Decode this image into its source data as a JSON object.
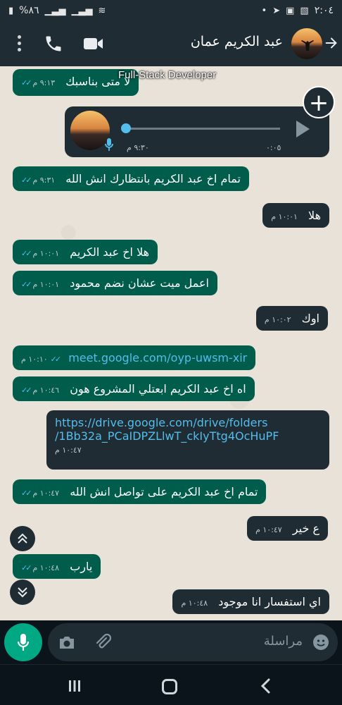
{
  "status_bar": {
    "time": "٢:٠٤",
    "battery": "%٨٦",
    "icons": [
      "telegram-icon",
      "message-icon",
      "gallery-icon",
      "notification-dot-icon",
      "wifi-icon",
      "signal-icon",
      "signal-icon",
      "battery-icon"
    ]
  },
  "header": {
    "contact_name": "عبد الكريم عمان",
    "icons": [
      "back-arrow-icon",
      "avatar",
      "video-call-icon",
      "voice-call-icon",
      "more-options-icon"
    ]
  },
  "watermark": "Full-Stack Developer",
  "messages": [
    {
      "id": "m0",
      "dir": "out",
      "text": "لا متى بناسبك",
      "time": "٩:١٣ م",
      "ticks": "read"
    },
    {
      "id": "voice",
      "dir": "in",
      "type": "voice",
      "time": "٩:٣٠ م",
      "duration": "٠:٠٥"
    },
    {
      "id": "m1",
      "dir": "out",
      "text": "تمام اخ عبد الكريم بانتظارك انش الله",
      "time": "٩:٣١ م",
      "ticks": "read"
    },
    {
      "id": "m2",
      "dir": "in",
      "text": "هلا",
      "time": "١٠:٠١ م"
    },
    {
      "id": "m3",
      "dir": "out",
      "text": "هلا اخ عبد الكريم",
      "time": "١٠:٠١ م",
      "ticks": "read"
    },
    {
      "id": "m4",
      "dir": "out",
      "text": "اعمل ميت عشان نضم محمود",
      "time": "١٠:٠١ م",
      "ticks": "read"
    },
    {
      "id": "m5",
      "dir": "in",
      "text": "اوك",
      "time": "١٠:٠٢ م"
    },
    {
      "id": "m6",
      "dir": "out",
      "text": "meet.google.com/oyp-uwsm-xir",
      "time": "١٠:١٠ م",
      "ticks": "read",
      "link": true
    },
    {
      "id": "m7",
      "dir": "out",
      "text": "اه اخ عبد الكريم ابعتلي المشروع هون",
      "time": "١٠:٤٦ م",
      "ticks": "read"
    },
    {
      "id": "m8",
      "dir": "in",
      "text_line1": "https://drive.google.com/drive/folders",
      "text_line2": "/1Bb32a_PCaIDPZLlwT_ckIyTtg4OcHuPF",
      "time": "١٠:٤٧ م",
      "link": true
    },
    {
      "id": "m9",
      "dir": "out",
      "text": "تمام اخ عبد الكريم على تواصل انش الله",
      "time": "١٠:٤٧ م",
      "ticks": "read"
    },
    {
      "id": "m10",
      "dir": "in",
      "text": "ع خير",
      "time": "١٠:٤٧ م"
    },
    {
      "id": "m11",
      "dir": "out",
      "text": "يارب",
      "time": "١٠:٤٨ م",
      "ticks": "read"
    },
    {
      "id": "m12",
      "dir": "in",
      "text": "اي استفسار انا موجود",
      "time": "١٠:٤٨ م"
    }
  ],
  "input": {
    "placeholder": "مراسلة",
    "icons": [
      "emoji-icon",
      "attach-icon",
      "camera-icon",
      "mic-icon"
    ]
  },
  "colors": {
    "outgoing_bubble": "#005c4b",
    "incoming_bubble": "#1f2c34",
    "header": "#1f2c34",
    "link": "#53bdeb",
    "mic_button": "#00a884"
  }
}
